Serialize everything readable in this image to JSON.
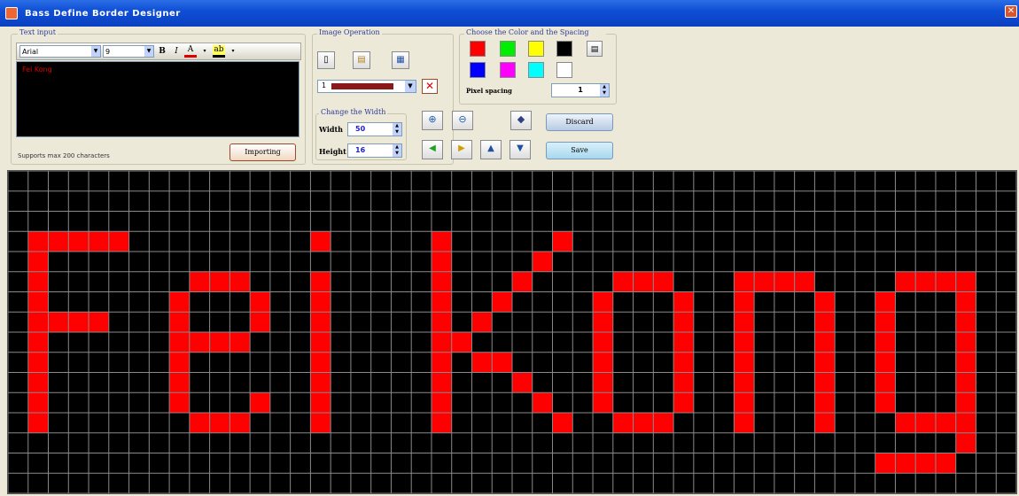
{
  "window": {
    "title": "Bass Define Border Designer",
    "close": "✕"
  },
  "text_input": {
    "legend": "Text input",
    "font": "Arial",
    "size": "9",
    "content": "Fei Kong",
    "support_note": "Supports max 200 characters",
    "import_label": "Importing"
  },
  "image_operation": {
    "legend": "Image Operation",
    "selected_image": "1",
    "size_legend": "Change the Width",
    "width_label": "Width",
    "width_value": "50",
    "height_label": "Height",
    "height_value": "16"
  },
  "colors": {
    "legend": "Choose the Color and the Spacing",
    "palette": [
      "#ff0000",
      "#00ee00",
      "#ffff00",
      "#000000",
      "#0000ff",
      "#ff00ff",
      "#00ffff",
      "#ffffff"
    ],
    "pixel_spacing_label": "Pixel spacing",
    "pixel_spacing_value": "1"
  },
  "buttons": {
    "discard": "Discard",
    "save": "Save"
  },
  "led": {
    "color": "#ff0000",
    "grid_line": "#8a8a8a",
    "background": "#000000",
    "cols": 50,
    "rows": 16
  }
}
